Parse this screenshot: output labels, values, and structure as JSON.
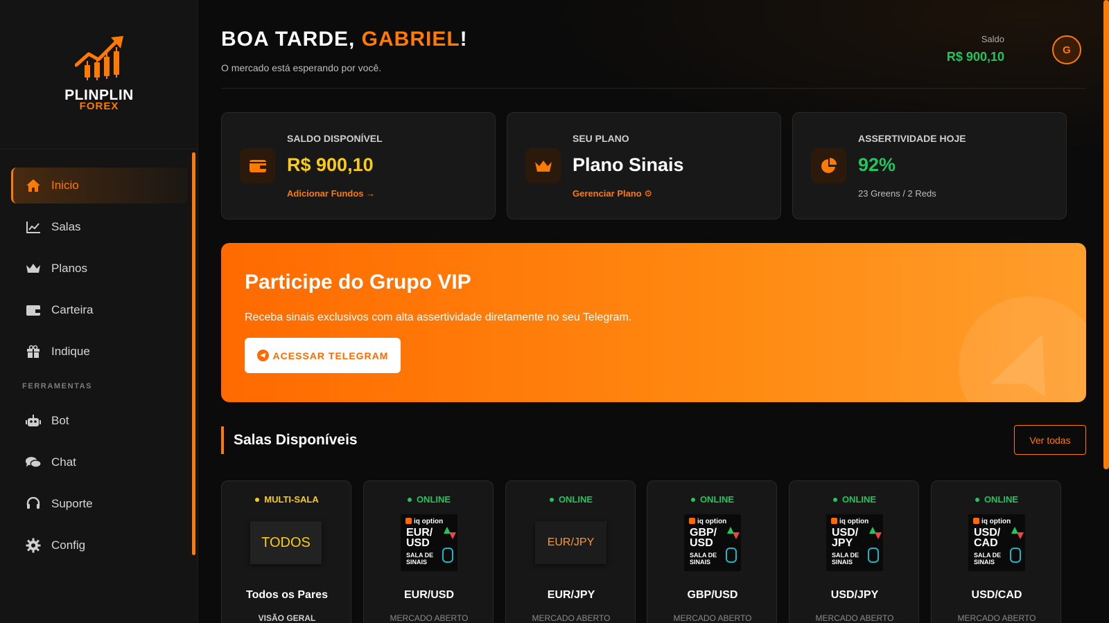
{
  "brand": {
    "line1": "PLINPLIN",
    "line2": "FOREX",
    "accent": "#ff7a00"
  },
  "sidebar": {
    "items": [
      {
        "label": "Inicio",
        "icon": "home-icon",
        "active": true
      },
      {
        "label": "Salas",
        "icon": "chart-line-icon"
      },
      {
        "label": "Planos",
        "icon": "crown-icon"
      },
      {
        "label": "Carteira",
        "icon": "wallet-icon"
      },
      {
        "label": "Indique",
        "icon": "gift-icon"
      }
    ],
    "section_label": "FERRAMENTAS",
    "tools": [
      {
        "label": "Bot",
        "icon": "robot-icon"
      },
      {
        "label": "Chat",
        "icon": "chat-icon"
      },
      {
        "label": "Suporte",
        "icon": "headset-icon"
      },
      {
        "label": "Config",
        "icon": "gear-icon"
      }
    ]
  },
  "header": {
    "greeting_prefix": "BOA TARDE, ",
    "greeting_name": "GABRIEL",
    "greeting_suffix": "!",
    "subtitle": "O mercado está esperando por você.",
    "balance_label": "Saldo",
    "balance_value": "R$ 900,10",
    "avatar_initial": "G"
  },
  "cards": [
    {
      "label": "SALDO DISPONÍVEL",
      "value": "R$ 900,10",
      "link": "Adicionar Fundos",
      "icon": "wallet-icon",
      "value_color": "#facc15"
    },
    {
      "label": "SEU PLANO",
      "value": "Plano Sinais",
      "link": "Gerenciar Plano",
      "icon": "crown-icon",
      "value_color": "#ffffff"
    },
    {
      "label": "ASSERTIVIDADE HOJE",
      "value": "92%",
      "sub": "23 Greens / 2 Reds",
      "icon": "pie-chart-icon",
      "value_color": "#22c55e"
    }
  ],
  "vip": {
    "title": "Participe do Grupo VIP",
    "description": "Receba sinais exclusivos com alta assertividade diretamente no seu Telegram.",
    "button_label": "ACESSAR TELEGRAM"
  },
  "rooms_section": {
    "title": "Salas Disponíveis",
    "view_all": "Ver todas"
  },
  "rooms": [
    {
      "status": "MULTI-SALA",
      "thumb_text": "TODOS",
      "name": "Todos os Pares",
      "sub": "VISÃO GERAL"
    },
    {
      "status": "ONLINE",
      "brand": "iq option",
      "pair_line1": "EUR/",
      "pair_line2": "USD",
      "sala_line1": "SALA DE",
      "sala_line2": "SINAIS",
      "name": "EUR/USD",
      "sub": "MERCADO ABERTO"
    },
    {
      "status": "ONLINE",
      "thumb_text": "EUR/JPY",
      "name": "EUR/JPY",
      "sub": "MERCADO ABERTO"
    },
    {
      "status": "ONLINE",
      "brand": "iq option",
      "pair_line1": "GBP/",
      "pair_line2": "USD",
      "sala_line1": "SALA DE",
      "sala_line2": "SINAIS",
      "name": "GBP/USD",
      "sub": "MERCADO ABERTO"
    },
    {
      "status": "ONLINE",
      "brand": "iq option",
      "pair_line1": "USD/",
      "pair_line2": "JPY",
      "sala_line1": "SALA DE",
      "sala_line2": "SINAIS",
      "name": "USD/JPY",
      "sub": "MERCADO ABERTO"
    },
    {
      "status": "ONLINE",
      "brand": "iq option",
      "pair_line1": "USD/",
      "pair_line2": "CAD",
      "sala_line1": "SALA DE",
      "sala_line2": "SINAIS",
      "name": "USD/CAD",
      "sub": "MERCADO ABERTO"
    }
  ]
}
